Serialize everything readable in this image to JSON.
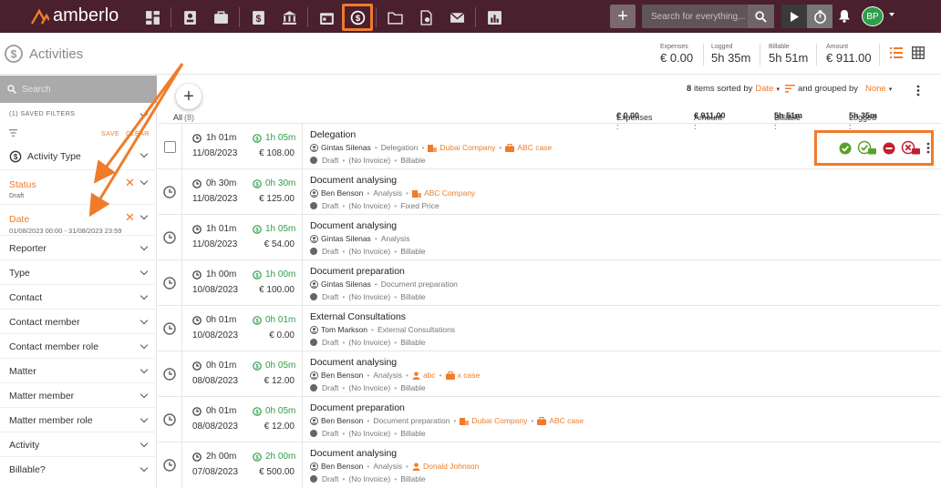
{
  "app": {
    "name": "amberlo"
  },
  "topbar": {
    "search_placeholder": "Search for everything...",
    "avatar_initials": "BP",
    "nav_icons": [
      "dashboard-icon",
      "contacts-icon",
      "matters-icon",
      "billing-icon",
      "bank-icon",
      "calendar-icon",
      "activities-icon",
      "folder-icon",
      "documents-icon",
      "mail-icon",
      "reports-icon"
    ]
  },
  "page": {
    "title": "Activities"
  },
  "stats": [
    {
      "label": "Expenses",
      "value": "€ 0.00"
    },
    {
      "label": "Logged",
      "value": "5h 35m"
    },
    {
      "label": "Billable",
      "value": "5h 51m"
    },
    {
      "label": "Amount",
      "value": "€ 911.00"
    }
  ],
  "sidebar": {
    "search_placeholder": "Search",
    "saved_filters": "(1) SAVED FILTERS",
    "save_label": "SAVE",
    "clear_label": "CLEAR",
    "activity_type": "Activity Type",
    "status": {
      "label": "Status",
      "value": "Draft"
    },
    "date": {
      "label": "Date",
      "value": "01/08/2023 00:00 - 31/08/2023 23:59"
    },
    "filters": [
      "Reporter",
      "Type",
      "Contact",
      "Contact member",
      "Contact member role",
      "Matter",
      "Matter member",
      "Matter member role",
      "Activity",
      "Billable?"
    ]
  },
  "list": {
    "count": "8",
    "sorted_by_text": "items sorted by",
    "sort_field": "Date",
    "grouped_text": "and grouped by",
    "group_field": "None",
    "tab_all": "All",
    "tab_all_count": "(8)",
    "totals": {
      "expenses_label": "Expenses :",
      "expenses": "€ 0.00",
      "amount_label": "Amount :",
      "amount": "€ 911.00",
      "billable_label": "Billable :",
      "billable": "5h 51m",
      "logged_label": "Logged :",
      "logged": "5h 35m"
    }
  },
  "rows": [
    {
      "logged": "1h 01m",
      "billable": "1h 05m",
      "date": "11/08/2023",
      "amount": "€ 108.00",
      "title": "Delegation",
      "user": "Gintas Silenas",
      "type": "Delegation",
      "contact": "Dubai Company",
      "matter": "ABC case",
      "person": "",
      "status": "Draft",
      "invoice": "(No Invoice)",
      "billing": "Billable"
    },
    {
      "logged": "0h 30m",
      "billable": "0h 30m",
      "date": "11/08/2023",
      "amount": "€ 125.00",
      "title": "Document analysing",
      "user": "Ben Benson",
      "type": "Analysis",
      "contact": "ABC Company",
      "matter": "",
      "person": "",
      "status": "Draft",
      "invoice": "(No Invoice)",
      "billing": "Fixed Price"
    },
    {
      "logged": "1h 01m",
      "billable": "1h 05m",
      "date": "11/08/2023",
      "amount": "€ 54.00",
      "title": "Document analysing",
      "user": "Gintas Silenas",
      "type": "Analysis",
      "contact": "",
      "matter": "",
      "person": "",
      "status": "Draft",
      "invoice": "(No Invoice)",
      "billing": "Billable"
    },
    {
      "logged": "1h 00m",
      "billable": "1h 00m",
      "date": "10/08/2023",
      "amount": "€ 100.00",
      "title": "Document preparation",
      "user": "Gintas Silenas",
      "type": "Document preparation",
      "contact": "",
      "matter": "",
      "person": "",
      "status": "Draft",
      "invoice": "(No Invoice)",
      "billing": "Billable"
    },
    {
      "logged": "0h 01m",
      "billable": "0h 01m",
      "date": "10/08/2023",
      "amount": "€ 0.00",
      "title": "External Consultations",
      "user": "Tom Markson",
      "type": "External Consultations",
      "contact": "",
      "matter": "",
      "person": "",
      "status": "Draft",
      "invoice": "(No Invoice)",
      "billing": "Billable"
    },
    {
      "logged": "0h 01m",
      "billable": "0h 05m",
      "date": "08/08/2023",
      "amount": "€ 12.00",
      "title": "Document analysing",
      "user": "Ben Benson",
      "type": "Analysis",
      "contact": "",
      "matter": "x case",
      "person": "abc",
      "status": "Draft",
      "invoice": "(No Invoice)",
      "billing": "Billable"
    },
    {
      "logged": "0h 01m",
      "billable": "0h 05m",
      "date": "08/08/2023",
      "amount": "€ 12.00",
      "title": "Document preparation",
      "user": "Ben Benson",
      "type": "Document preparation",
      "contact": "Dubai Company",
      "matter": "ABC case",
      "person": "",
      "status": "Draft",
      "invoice": "(No Invoice)",
      "billing": "Billable"
    },
    {
      "logged": "2h 00m",
      "billable": "2h 00m",
      "date": "07/08/2023",
      "amount": "€ 500.00",
      "title": "Document analysing",
      "user": "Ben Benson",
      "type": "Analysis",
      "contact": "",
      "matter": "",
      "person": "Donald Johnson",
      "status": "Draft",
      "invoice": "(No Invoice)",
      "billing": "Billable"
    }
  ],
  "colors": {
    "topbar": "#4a1f2e",
    "accent": "#f07b2a",
    "billable_green": "#2e9e4a"
  }
}
